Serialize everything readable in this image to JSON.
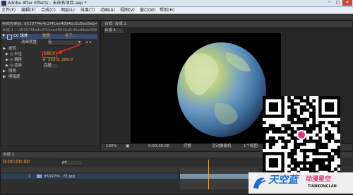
{
  "window": {
    "title": "Adobe After Effects - 未命名项目.aep *",
    "minimize": "─",
    "maximize": "□",
    "close": "✕"
  },
  "menu": {
    "items": [
      "文件(F)",
      "编辑(E)",
      "合成(C)",
      "图层(L)",
      "效果(T)",
      "动画(A)",
      "视图(V)",
      "窗口(W)",
      "帮助(H)"
    ]
  },
  "effect_controls": {
    "header_tab": "特效控制台: d5397f4e4c2f41ee4894bd1d5ad9eb408f3.jpg",
    "sub_tab": "合成 1 • d5397f4e4c2f41ee4894bd1d5ad9eb408f3.jpg",
    "effect_name": "CC 球体",
    "reset_label": "重置",
    "about_label": "关于...",
    "animation_preset_label": "动画预置:",
    "animation_preset_value": "无",
    "params": [
      {
        "label": "旋转",
        "value": "",
        "twirl": "▶"
      },
      {
        "label": "半径",
        "value": "185.0",
        "twirl": "▶"
      },
      {
        "label": "偏移",
        "value": "252.0, 289.0",
        "twirl": "▶"
      },
      {
        "label": "渲染",
        "value": "完整",
        "twirl": "▶"
      },
      {
        "label": "照明",
        "value": "",
        "twirl": "▶"
      },
      {
        "label": "明暗度",
        "value": "",
        "twirl": "▶"
      }
    ]
  },
  "composition": {
    "tab": "合成: 合成 1",
    "sub_tab": "合成 1",
    "zoom": "100%",
    "timecode": "0:00:00:00",
    "resolution": "完整",
    "camera": "活动摄像机",
    "views": "1个视图"
  },
  "timeline": {
    "tab": "合成 1",
    "timecode": "0:00:00:00",
    "layer_name": "d5397f4...f3.jpg",
    "layer_number": "1",
    "search_placeholder": "ρ▾"
  },
  "watermark": {
    "brand_cn": "天空蓝",
    "subtitle_cn": "动漫星空",
    "brand_en": "TIANKONGLAN"
  }
}
